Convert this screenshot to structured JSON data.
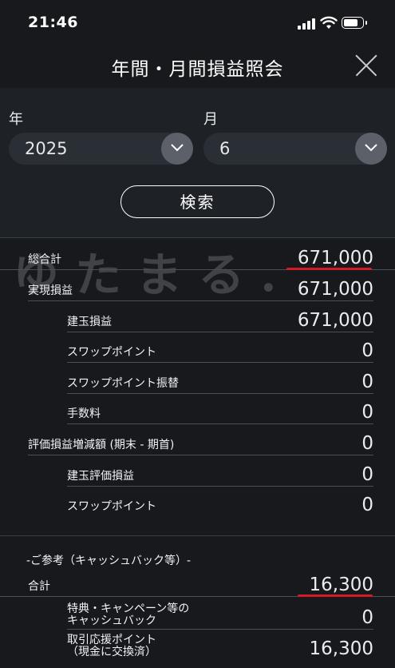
{
  "status_bar": {
    "time": "21:46"
  },
  "header": {
    "title": "年間・月間損益照会"
  },
  "filters": {
    "year_label": "年",
    "year_value": "2025",
    "month_label": "月",
    "month_value": "6",
    "search_label": "検索"
  },
  "summary": {
    "total_label": "総合計",
    "total_value": "671,000",
    "realized_label": "実現損益",
    "realized_value": "671,000",
    "position_pl_label": "建玉損益",
    "position_pl_value": "671,000",
    "swap_label": "スワップポイント",
    "swap_value": "0",
    "swap_transfer_label": "スワップポイント振替",
    "swap_transfer_value": "0",
    "fee_label": "手数料",
    "fee_value": "0",
    "valuation_change_label": "評価損益増減額 (期末 - 期首)",
    "valuation_change_value": "0",
    "position_valuation_label": "建玉評価損益",
    "position_valuation_value": "0",
    "valuation_swap_label": "スワップポイント",
    "valuation_swap_value": "0"
  },
  "reference": {
    "heading": "-ご参考（キャッシュバック等）-",
    "total_label": "合計",
    "total_value": "16,300",
    "cashback_label_1": "特典・キャンペーン等の",
    "cashback_label_2": "キャッシュバック",
    "cashback_value": "0",
    "points_label_1": "取引応援ポイント",
    "points_label_2": "（現金に交換済）",
    "points_value": "16,300"
  },
  "watermark_text": "ゆたまる.",
  "colors": {
    "background": "#17191d",
    "panel": "#1e2227",
    "highlight": "#d41a24"
  }
}
